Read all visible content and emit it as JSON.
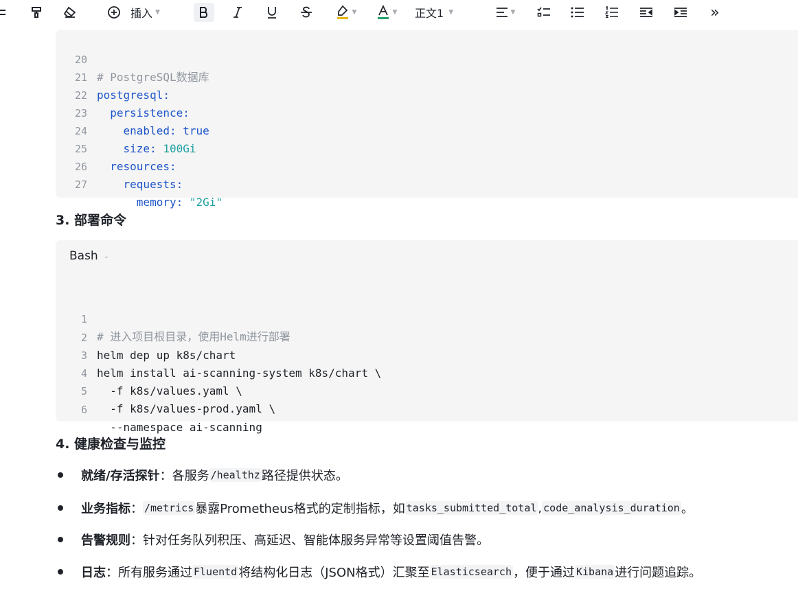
{
  "toolbar": {
    "insert_label": "插入",
    "paragraph_style": "正文1",
    "more_label": "»"
  },
  "code1": {
    "lines": [
      {
        "n": "20",
        "comment": "# PostgreSQL数据库"
      },
      {
        "n": "21",
        "key": "postgresql:"
      },
      {
        "n": "22",
        "indent": "  ",
        "key": "persistence:"
      },
      {
        "n": "23",
        "indent": "    ",
        "key": "enabled:",
        "val": " true",
        "valtype": "bool"
      },
      {
        "n": "24",
        "indent": "    ",
        "key": "size:",
        "val": " 100Gi",
        "valtype": "num"
      },
      {
        "n": "25",
        "indent": "  ",
        "key": "resources:"
      },
      {
        "n": "26",
        "indent": "    ",
        "key": "requests:"
      },
      {
        "n": "27",
        "indent": "      ",
        "key": "memory:",
        "val": " \"2Gi\"",
        "valtype": "str"
      }
    ]
  },
  "section3": {
    "title": "3. 部署命令"
  },
  "code2": {
    "language": "Bash",
    "lines": [
      {
        "n": "1",
        "comment": "# 进入项目根目录，使用Helm进行部署"
      },
      {
        "n": "2",
        "text": "helm dep up k8s/chart"
      },
      {
        "n": "3",
        "text": "helm install ai-scanning-system k8s/chart \\"
      },
      {
        "n": "4",
        "text": "  -f k8s/values.yaml \\"
      },
      {
        "n": "5",
        "text": "  -f k8s/values-prod.yaml \\"
      },
      {
        "n": "6",
        "text": "  --namespace ai-scanning"
      }
    ]
  },
  "section4": {
    "title": "4. 健康检查与监控"
  },
  "bullets": {
    "b1": {
      "bold": "就绪/存活探针",
      "t1": "：各服务",
      "c1": "/healthz",
      "t2": "路径提供状态。"
    },
    "b2": {
      "bold": "业务指标",
      "t1": "：",
      "c1": "/metrics",
      "t2": "暴露Prometheus格式的定制指标，如",
      "c2": "tasks_submitted_total",
      "t3": ", ",
      "c3": "code_analysis_duration",
      "t4": "。"
    },
    "b3": {
      "bold": "告警规则",
      "t1": "：针对任务队列积压、高延迟、智能体服务异常等设置阈值告警。"
    },
    "b4": {
      "bold": "日志",
      "t1": "：所有服务通过",
      "c1": "Fluentd",
      "t2": "将结构化日志（JSON格式）汇聚至",
      "c2": "Elasticsearch",
      "t3": "，便于通过",
      "c3": "Kibana",
      "t4": "进行问题追踪。"
    }
  }
}
